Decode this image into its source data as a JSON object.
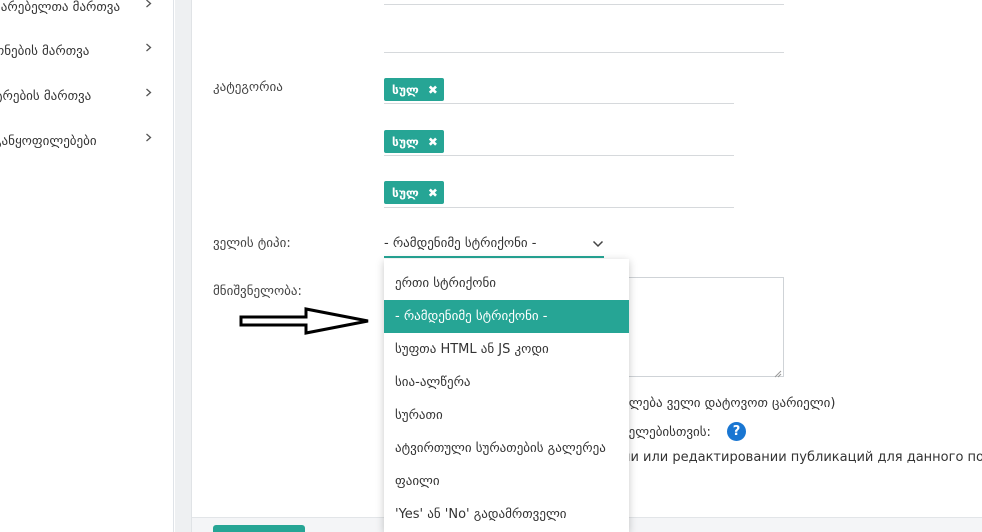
{
  "sidebar": {
    "items": [
      {
        "label": "მარებელთა მართვა"
      },
      {
        "label": "ონების მართვა"
      },
      {
        "label": "ტრების მართვა"
      },
      {
        "label": "განყოფილებები"
      }
    ]
  },
  "form": {
    "category_label": "კატეგორია",
    "tags": [
      {
        "label": "სულ"
      },
      {
        "label": "სულ"
      },
      {
        "label": "სულ"
      }
    ],
    "field_type_label": "ველის ტიპი:",
    "field_type_value": "- რამდენიმე სტრიქონი -",
    "meaning_label": "მნიშვნელობა:",
    "partial_text_1": "ძლება ველი დატოვოთ ცარიელი)",
    "partial_text_2": "ველებისთვის:",
    "partial_text_3": "ии или редактировании публикаций для данного поля"
  },
  "dropdown": {
    "options": [
      {
        "label": "ერთი სტრიქონი",
        "selected": false
      },
      {
        "label": "- რამდენიმე სტრიქონი -",
        "selected": true
      },
      {
        "label": "სუფთა HTML ან JS კოდი",
        "selected": false
      },
      {
        "label": "სია-ალწერა",
        "selected": false
      },
      {
        "label": "სურათი",
        "selected": false
      },
      {
        "label": "ატვირთული სურათების გალერეა",
        "selected": false
      },
      {
        "label": "ფაილი",
        "selected": false
      },
      {
        "label": "'Yes' ან 'No' გადამრთველი",
        "selected": false
      }
    ]
  },
  "colors": {
    "accent": "#26a595",
    "help": "#1976d2"
  }
}
